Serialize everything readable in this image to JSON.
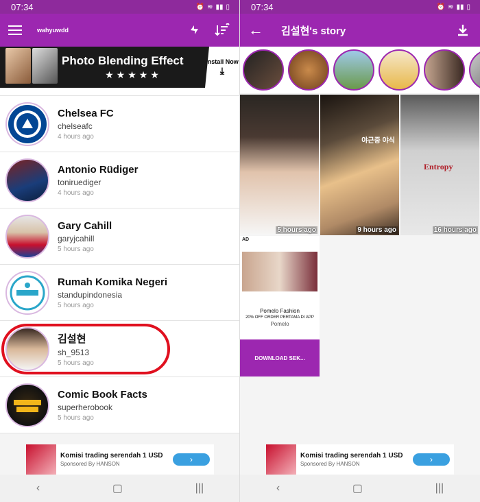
{
  "status": {
    "time": "07:34"
  },
  "left": {
    "appbar": {
      "username": "wahyuwdd"
    },
    "banner": {
      "title": "Photo Blending Effect",
      "stars": "★★★★★",
      "install": "Install Now"
    },
    "users": [
      {
        "name": "Chelsea FC",
        "handle": "chelseafc",
        "time": "4 hours ago"
      },
      {
        "name": "Antonio Rüdiger",
        "handle": "toniruediger",
        "time": "4 hours ago"
      },
      {
        "name": "Gary Cahill",
        "handle": "garyjcahill",
        "time": "5 hours ago"
      },
      {
        "name": "Rumah Komika Negeri",
        "handle": "standupindonesia",
        "time": "5 hours ago"
      },
      {
        "name": "김설현",
        "handle": "sh_9513",
        "time": "5 hours ago"
      },
      {
        "name": "Comic Book Facts",
        "handle": "superherobook",
        "time": "5 hours ago"
      }
    ],
    "ad": {
      "title": "Komisi trading serendah 1 USD",
      "sponsor": "Sponsored By HANSON"
    }
  },
  "right": {
    "appbar": {
      "title": "김설현's story"
    },
    "stories": [
      {
        "time": "5 hours ago",
        "caption": ""
      },
      {
        "time": "9 hours ago",
        "caption": "야근중 야식"
      },
      {
        "time": "16 hours ago",
        "caption": "Entropy"
      }
    ],
    "ad_cell": {
      "label": "AD",
      "brand_line": "Pomelo Fashion",
      "promo": "20% OFF ORDER PERTAMA DI APP",
      "brand": "Pomelo",
      "cta": "DOWNLOAD SEK..."
    },
    "ad": {
      "title": "Komisi trading serendah 1 USD",
      "sponsor": "Sponsored By HANSON"
    }
  },
  "colors": {
    "primary": "#9c27b0",
    "status": "#8e2a9c",
    "highlight": "#e0101f",
    "cta": "#3aa0e0"
  }
}
